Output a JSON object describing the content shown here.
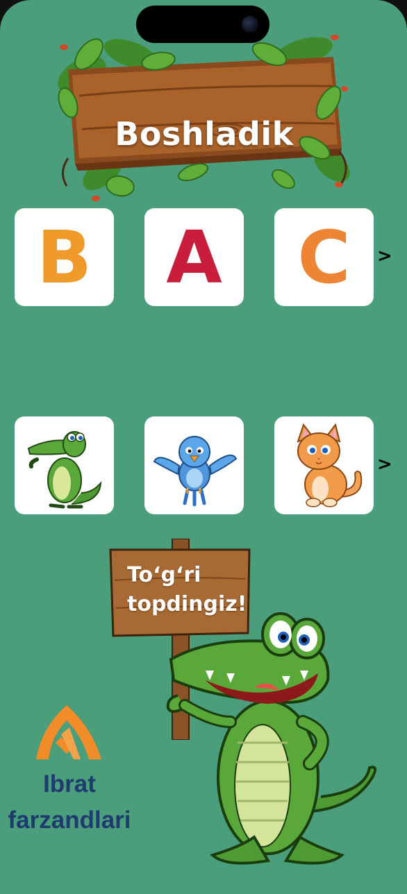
{
  "header": {
    "title": "Boshladik"
  },
  "letters": [
    {
      "char": "B",
      "color": "#ef9a2a"
    },
    {
      "char": "A",
      "color": "#c81e3c"
    },
    {
      "char": "C",
      "color": "#ee8535"
    }
  ],
  "letters_next": ">",
  "pictures": [
    {
      "icon": "crocodile-icon"
    },
    {
      "icon": "bird-icon"
    },
    {
      "icon": "cat-icon"
    }
  ],
  "pictures_next": ">",
  "feedback": {
    "line1": "To‘g‘ri",
    "line2": "topdingiz!"
  },
  "brand": {
    "line1": "Ibrat",
    "line2": "farzandlari",
    "color": "#1e3a6e",
    "accent": "#f28c28"
  },
  "colors": {
    "background": "#4a9e7c",
    "card": "#ffffff"
  }
}
